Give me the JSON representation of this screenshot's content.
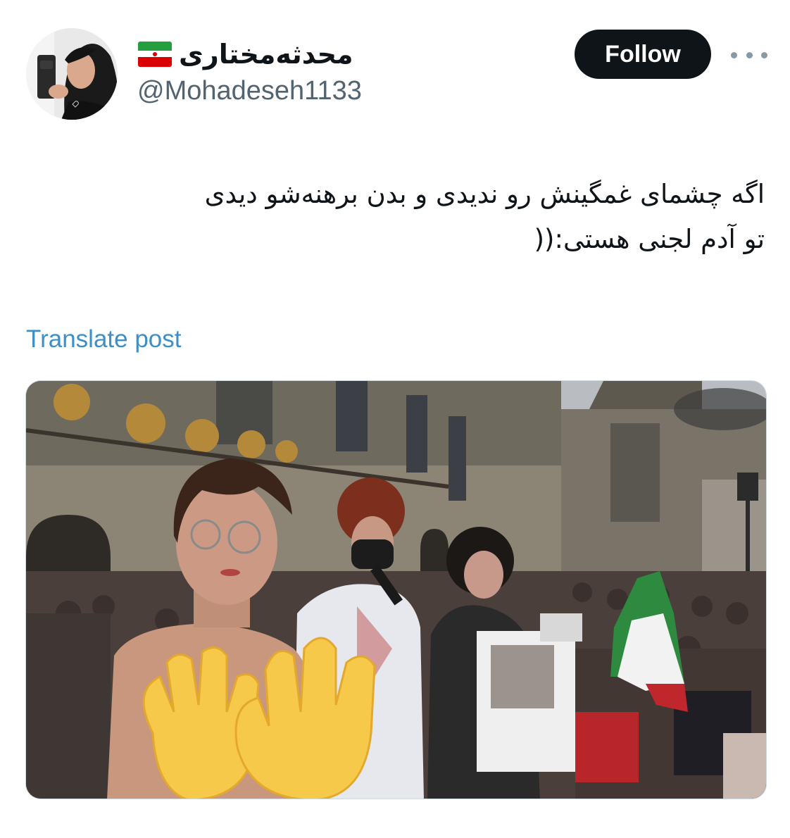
{
  "author": {
    "display_name": "محدثه‌مختاری",
    "flag_icon": "iran-flag-icon",
    "handle": "@Mohadeseh1133",
    "avatar_icon": "avatar-image"
  },
  "actions": {
    "follow_label": "Follow",
    "more_icon": "more-dots-icon"
  },
  "post": {
    "lines": [
      "اگه چشمای غمگینش رو ندیدی و بدن برهنه‌شو دیدی",
      "تو آدم لجنی هستی:(("
    ],
    "translate_label": "Translate post"
  },
  "media": {
    "type": "photo",
    "overlay_icons": [
      "waving-hand-emoji",
      "waving-hand-emoji"
    ]
  },
  "colors": {
    "text": "#0f1419",
    "secondary": "#536471",
    "link": "#3f8fc7",
    "follow_bg": "#0f1419",
    "follow_text": "#ffffff"
  }
}
